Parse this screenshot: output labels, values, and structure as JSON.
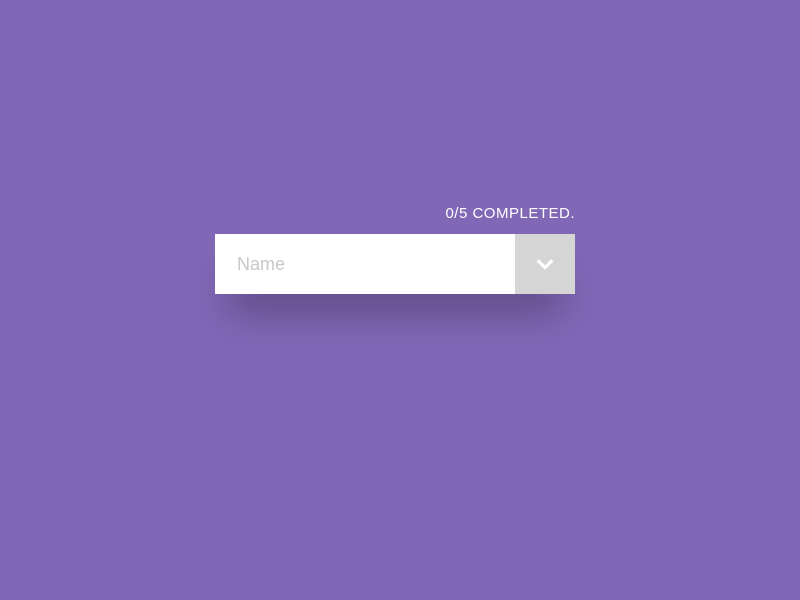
{
  "progress": {
    "current": 0,
    "total": 5,
    "text": "0/5 COMPLETED."
  },
  "field": {
    "label": "Name"
  },
  "colors": {
    "background": "#8168B7",
    "fieldBg": "#ffffff",
    "buttonBg": "#d5d5d5",
    "labelText": "#c8c8c8",
    "progressText": "#ffffff",
    "chevron": "#ffffff"
  }
}
